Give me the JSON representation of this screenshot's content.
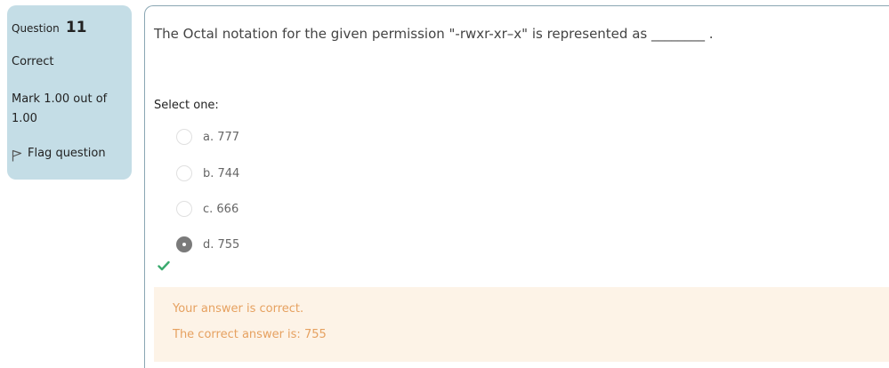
{
  "info": {
    "question_label": "Question",
    "question_number": "11",
    "state": "Correct",
    "grade": "Mark 1.00 out of 1.00",
    "flag_label": "Flag question"
  },
  "question": {
    "text": "The Octal notation for the given permission \"-rwxr-xr–x\" is represented as ________ .",
    "prompt": "Select one:",
    "options": [
      {
        "label": "a. 777",
        "selected": false
      },
      {
        "label": "b. 744",
        "selected": false
      },
      {
        "label": "c. 666",
        "selected": false
      },
      {
        "label": "d. 755",
        "selected": true
      }
    ]
  },
  "feedback": {
    "result": "Your answer is correct.",
    "correct_answer": "The correct answer is: 755"
  },
  "colors": {
    "info_bg": "#c4dde6",
    "feedback_bg": "#fdf3e7",
    "feedback_text": "#e6a160",
    "check_green": "#3aaa6e"
  }
}
